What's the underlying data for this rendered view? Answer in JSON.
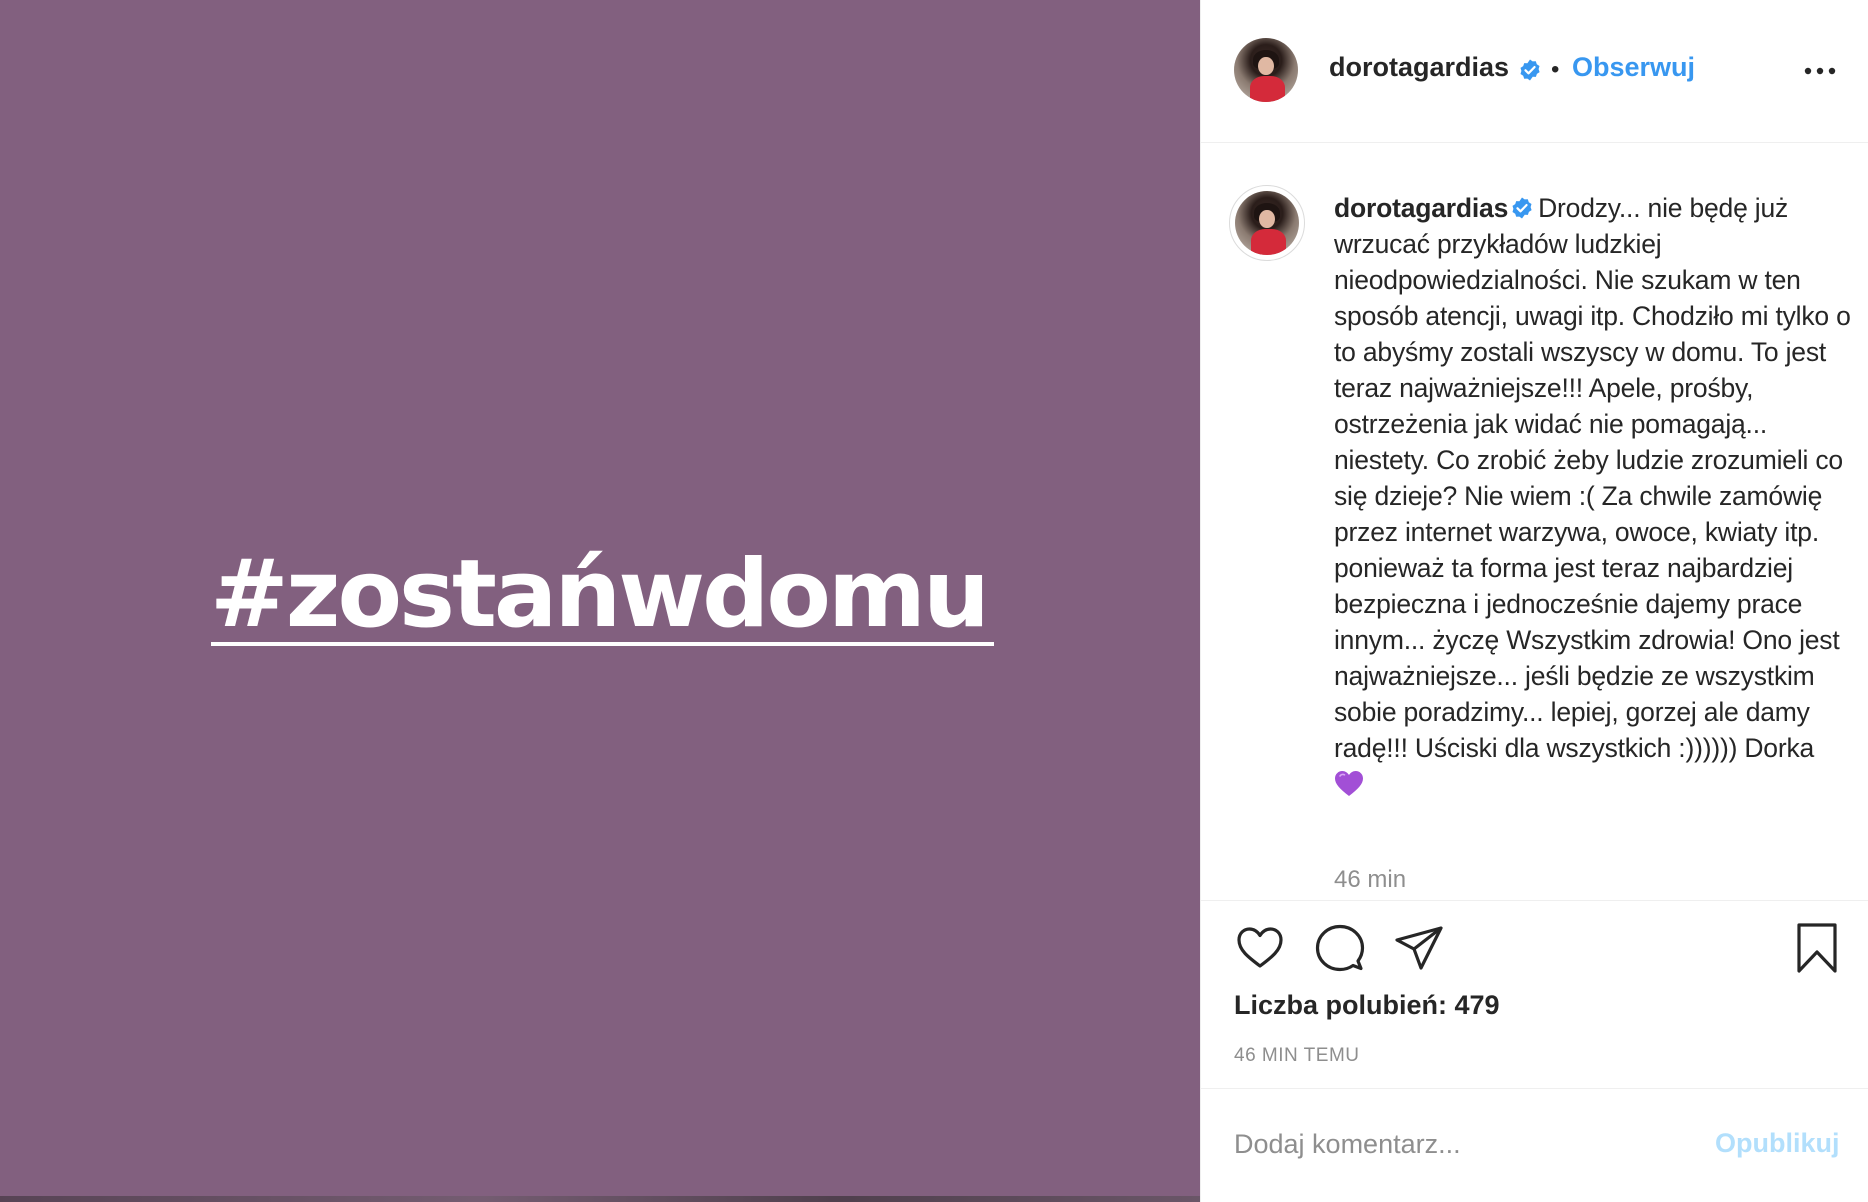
{
  "media": {
    "hashtag": "#zostańwdomu",
    "background_color": "#82607f"
  },
  "header": {
    "username": "dorotagardias",
    "verified": true,
    "separator": "•",
    "follow_label": "Obserwuj",
    "more_icon": "more-options-icon"
  },
  "caption": {
    "username": "dorotagardias",
    "verified": true,
    "text": "Drodzy... nie będę już wrzucać przykładów ludzkiej nieodpowiedzialności. Nie szukam w ten sposób atencji, uwagi itp. Chodziło mi tylko o to abyśmy zostali wszyscy w domu. To jest teraz najważniejsze!!! Apele, prośby, ostrzeżenia jak widać nie pomagają... niestety. Co zrobić żeby ludzie zrozumieli co się dzieje? Nie wiem :( Za chwile zamówię przez internet warzywa, owoce, kwiaty itp. ponieważ ta forma jest teraz najbardziej bezpieczna i jednocześnie dajemy prace innym... życzę Wszystkim zdrowia! Ono jest najważniejsze... jeśli będzie ze wszystkim sobie poradzimy... lepiej, gorzej ale damy radę!!! Uściski dla wszystkich :)))))) Dorka",
    "emoji": "purple-heart-icon",
    "time": "46 min"
  },
  "actions": {
    "like_icon": "heart-icon",
    "comment_icon": "comment-icon",
    "share_icon": "share-icon",
    "save_icon": "bookmark-icon"
  },
  "likes_label": "Liczba polubień: 479",
  "timestamp": "46 MIN TEMU",
  "comment": {
    "placeholder": "Dodaj komentarz...",
    "publish_label": "Opublikuj"
  },
  "colors": {
    "accent": "#3897f0",
    "publish_disabled": "#b2dffc",
    "verified_badge": "#3897f0",
    "emoji_heart": "#a24fd6"
  }
}
